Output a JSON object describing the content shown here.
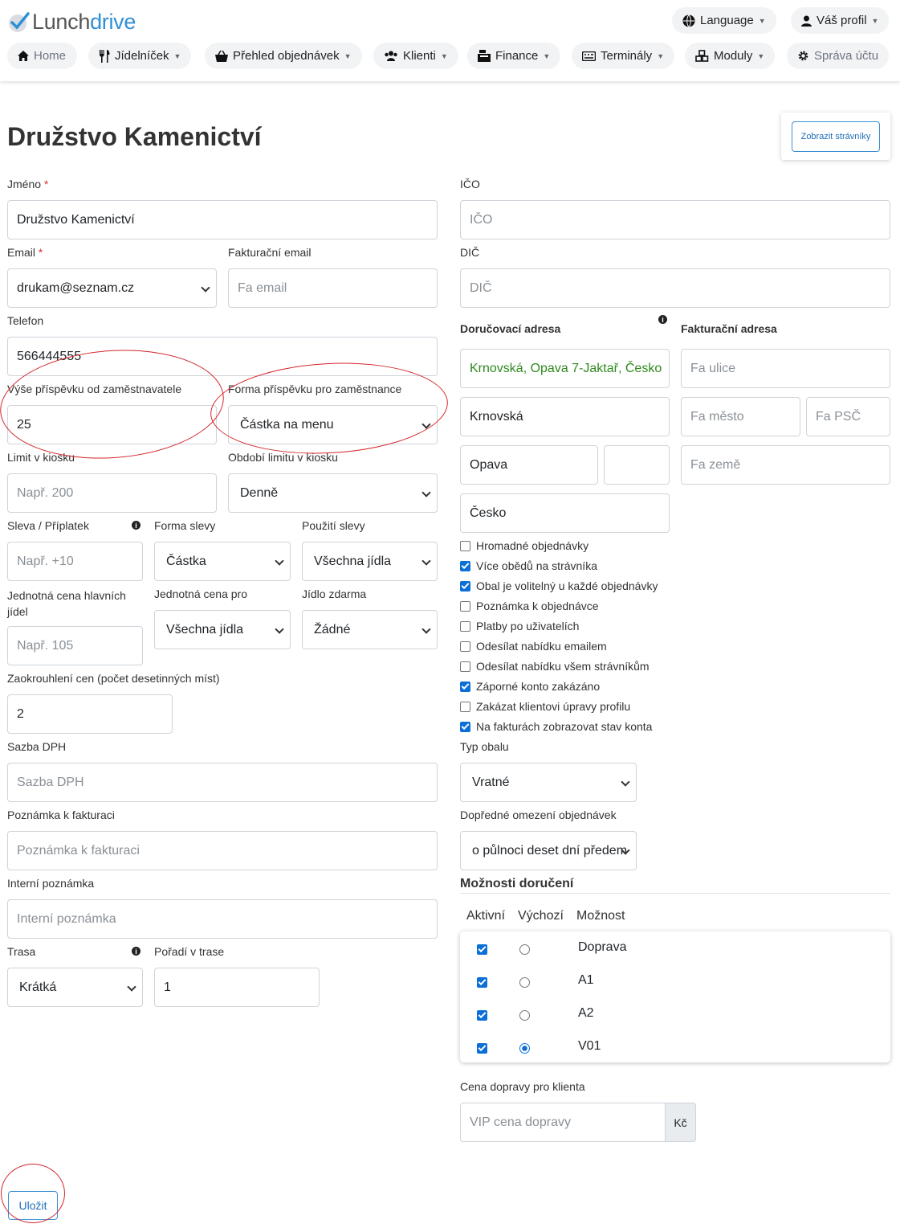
{
  "brand": {
    "part1": "Lunch",
    "part2": "drive"
  },
  "header": {
    "language": "Language",
    "profile": "Váš profil"
  },
  "nav": {
    "home": "Home",
    "menu": "Jídelníček",
    "orders": "Přehled objednávek",
    "clients": "Klienti",
    "finance": "Finance",
    "terminals": "Terminály",
    "modules": "Moduly",
    "account": "Správa účtu"
  },
  "page": {
    "title": "Družstvo Kamenictví",
    "show_diners": "Zobrazit strávníky",
    "save": "Uložit"
  },
  "form": {
    "name": {
      "label": "Jméno",
      "required": "*",
      "value": "Družstvo Kamenictví"
    },
    "ico": {
      "label": "IČO",
      "placeholder": "IČO"
    },
    "email": {
      "label": "Email",
      "required": "*",
      "value": "drukam@seznam.cz"
    },
    "billing_email": {
      "label": "Fakturační email",
      "placeholder": "Fa email"
    },
    "dic": {
      "label": "DIČ",
      "placeholder": "DIČ"
    },
    "phone": {
      "label": "Telefon",
      "value": "566444555"
    },
    "contribution": {
      "label": "Výše příspěvku od zaměstnavatele",
      "value": "25"
    },
    "contribution_form": {
      "label": "Forma příspěvku pro zaměstnance",
      "value": "Částka na menu"
    },
    "kiosk_limit": {
      "label": "Limit v kiosku",
      "placeholder": "Např. 200"
    },
    "kiosk_period": {
      "label": "Období limitu v kiosku",
      "value": "Denně"
    },
    "discount": {
      "label": "Sleva / Příplatek",
      "placeholder": "Např. +10"
    },
    "discount_form": {
      "label": "Forma slevy",
      "value": "Částka"
    },
    "discount_use": {
      "label": "Použití slevy",
      "value": "Všechna jídla"
    },
    "unit_price": {
      "label_line1": "Jednotná cena hlavních",
      "label_line2": "jídel",
      "placeholder": "Např. 105"
    },
    "unit_price_for": {
      "label": "Jednotná cena pro",
      "value": "Všechna jídla"
    },
    "free_meal": {
      "label": "Jídlo zdarma",
      "value": "Žádné"
    },
    "rounding": {
      "label": "Zaokrouhlení cen (počet desetinných míst)",
      "value": "2"
    },
    "vat": {
      "label": "Sazba DPH",
      "placeholder": "Sazba DPH"
    },
    "invoice_note": {
      "label": "Poznámka k fakturaci",
      "placeholder": "Poznámka k fakturaci"
    },
    "internal_note": {
      "label": "Interní poznámka",
      "placeholder": "Interní poznámka"
    },
    "route": {
      "label": "Trasa",
      "value": "Krátká"
    },
    "route_order": {
      "label": "Pořadí v trase",
      "value": "1"
    }
  },
  "delivery_address": {
    "label": "Doručovací adresa",
    "full": "Krnovská, Opava 7-Jaktař, Česko",
    "street": "Krnovská",
    "city": "Opava",
    "zip": "",
    "country": "Česko"
  },
  "billing_address": {
    "label": "Fakturační adresa",
    "street_ph": "Fa ulice",
    "city_ph": "Fa město",
    "zip_ph": "Fa PSČ",
    "country_ph": "Fa země"
  },
  "options": [
    {
      "label": "Hromadné objednávky",
      "checked": false
    },
    {
      "label": "Více obědů na strávníka",
      "checked": true
    },
    {
      "label": "Obal je volitelný u každé objednávky",
      "checked": true
    },
    {
      "label": "Poznámka k objednávce",
      "checked": false
    },
    {
      "label": "Platby po uživatelích",
      "checked": false
    },
    {
      "label": "Odesílat nabídku emailem",
      "checked": false
    },
    {
      "label": "Odesílat nabídku všem strávníkům",
      "checked": false
    },
    {
      "label": "Záporné konto zakázáno",
      "checked": true
    },
    {
      "label": "Zakázat klientovi úpravy profilu",
      "checked": false
    },
    {
      "label": "Na fakturách zobrazovat stav konta",
      "checked": true
    }
  ],
  "package": {
    "label": "Typ obalu",
    "value": "Vratné"
  },
  "order_limit": {
    "label": "Dopředné omezení objednávek",
    "value": "o půlnoci deset dní předem"
  },
  "delivery": {
    "title": "Možnosti doručení",
    "col_active": "Aktivní",
    "col_default": "Výchozí",
    "col_option": "Možnost",
    "rows": [
      {
        "name": "Doprava",
        "active": true,
        "default": false
      },
      {
        "name": "A1",
        "active": true,
        "default": false
      },
      {
        "name": "A2",
        "active": true,
        "default": false
      },
      {
        "name": "V01",
        "active": true,
        "default": true
      }
    ],
    "price_label": "Cena dopravy pro klienta",
    "price_placeholder": "VIP cena dopravy",
    "currency": "Kč"
  }
}
